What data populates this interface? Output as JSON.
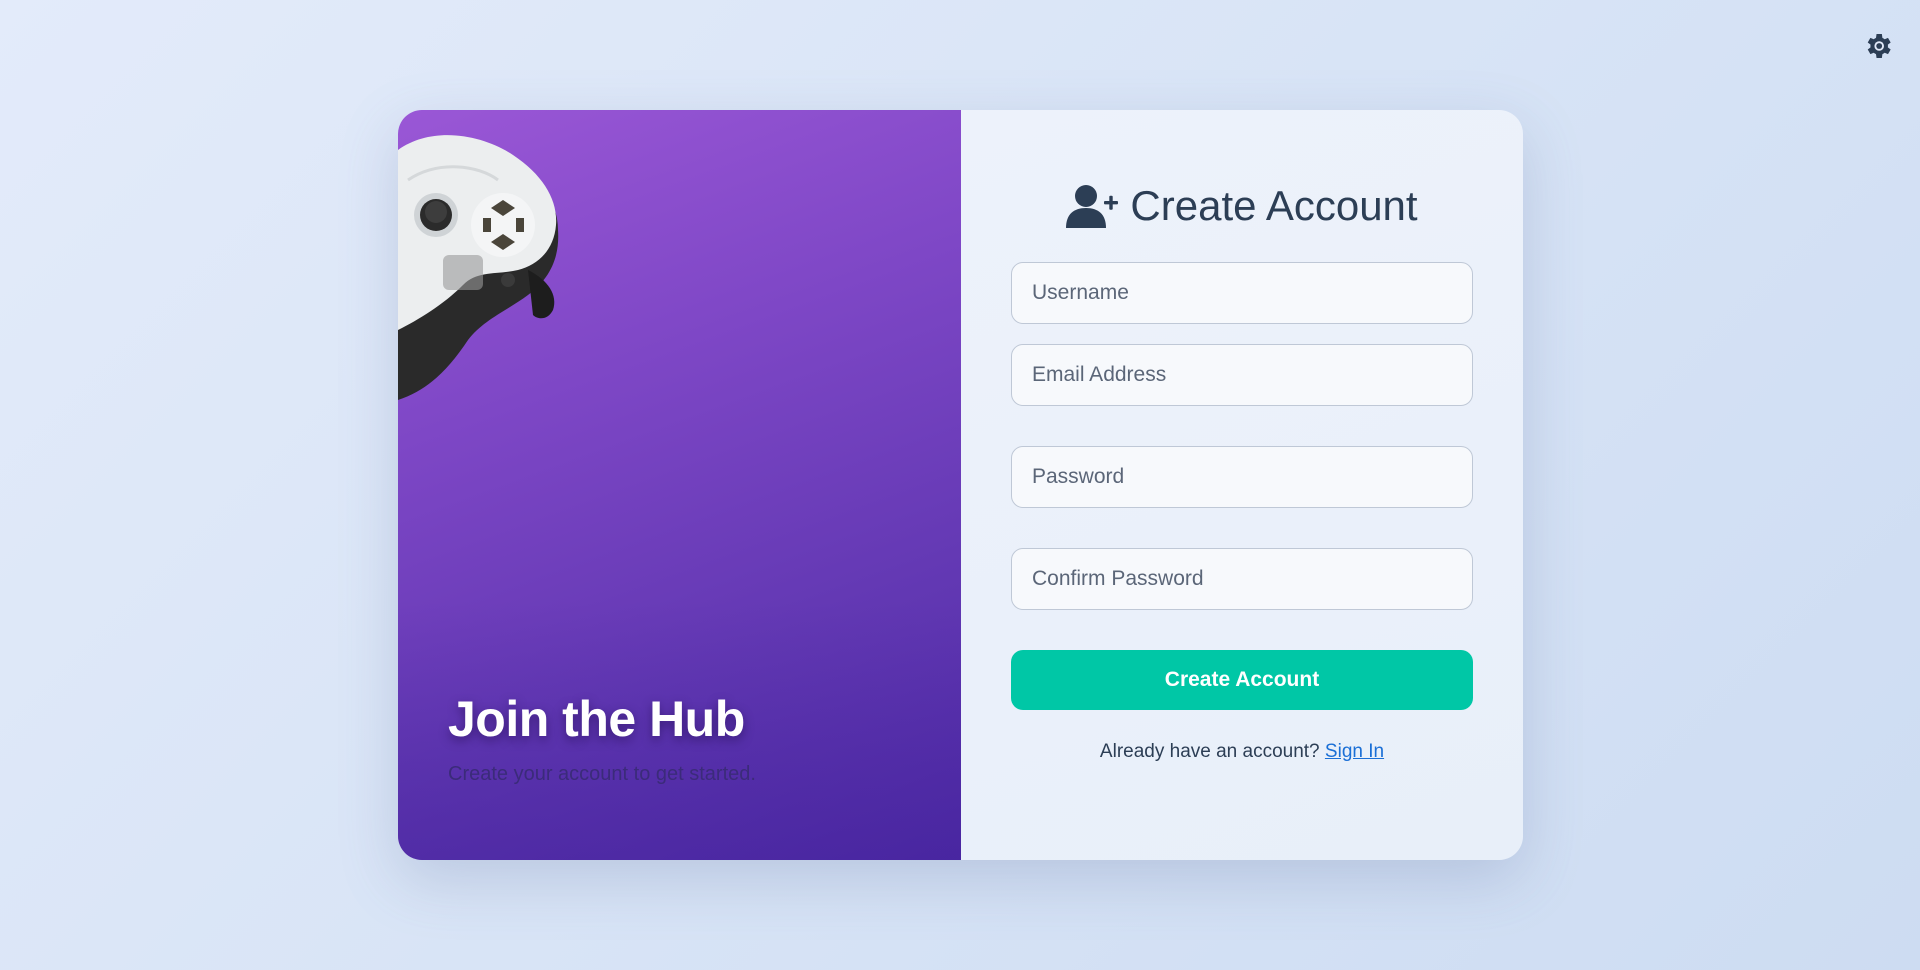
{
  "theme_toggle": {
    "icon": "gear-icon"
  },
  "hero": {
    "title": "Join the Hub",
    "subtitle": "Create your account to get started.",
    "image": "game-controller-image",
    "colors": {
      "gradient_start": "#9a57d6",
      "gradient_end": "#4f2aa6"
    }
  },
  "form": {
    "title": "Create Account",
    "title_icon": "user-plus-icon",
    "fields": {
      "username": {
        "placeholder": "Username",
        "value": ""
      },
      "email": {
        "placeholder": "Email Address",
        "value": ""
      },
      "password": {
        "placeholder": "Password",
        "value": ""
      },
      "confirm_password": {
        "placeholder": "Confirm Password",
        "value": ""
      }
    },
    "submit_label": "Create Account",
    "signin_prompt": "Already have an account?",
    "signin_link": "Sign In",
    "colors": {
      "accent": "#00c7a6",
      "link": "#1a6fd6"
    }
  }
}
